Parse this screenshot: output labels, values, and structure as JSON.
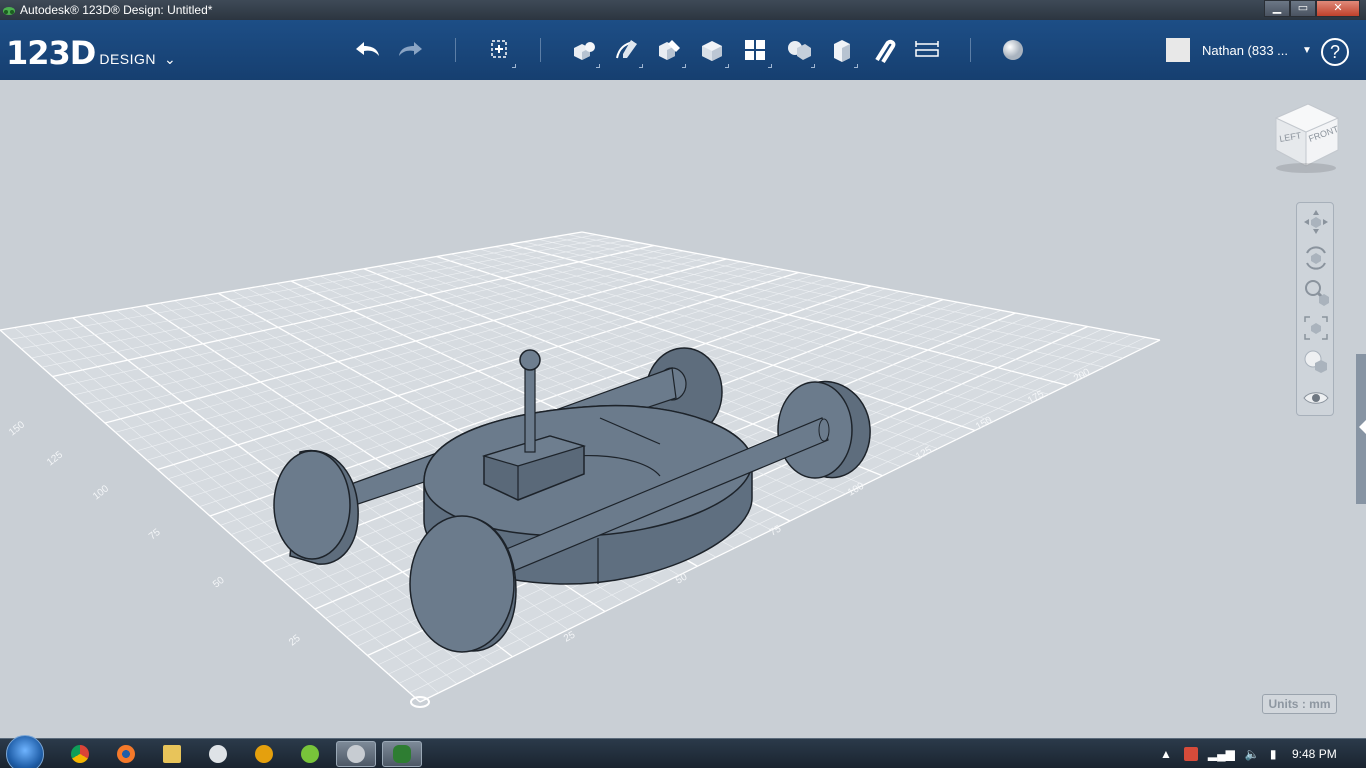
{
  "window": {
    "title": "Autodesk® 123D® Design: Untitled*",
    "minimize": "▁",
    "maximize": "▭",
    "close": "✕"
  },
  "app": {
    "logo_number": "123D",
    "logo_word": "DESIGN",
    "logo_chevron": "⌄"
  },
  "toolbar": {
    "icons": [
      "undo-icon",
      "redo-icon",
      "transform-icon",
      "primitives-icon",
      "sketch-icon",
      "construct-icon",
      "modify-icon",
      "pattern-icon",
      "grouping-icon",
      "combine-icon",
      "snap-icon",
      "measure-icon",
      "material-icon"
    ]
  },
  "user": {
    "name": "Nathan  (833 ...",
    "dropdown": "▼",
    "help": "?"
  },
  "viewport": {
    "viewcube_left": "LEFT",
    "viewcube_front": "FRONT",
    "units_label": "Units : mm",
    "grid_labels_left": [
      "25",
      "50",
      "75",
      "100",
      "125",
      "150"
    ],
    "grid_labels_right": [
      "25",
      "50",
      "75",
      "100",
      "125",
      "150",
      "175",
      "200"
    ],
    "model_color": "#6b7b8c"
  },
  "taskbar": {
    "clock": "9:48 PM",
    "apps": [
      "chrome-icon",
      "blender-icon",
      "explorer-icon",
      "steam-icon",
      "plex-icon",
      "utorrent-icon",
      "123d-icon",
      "123d-design-icon"
    ]
  }
}
